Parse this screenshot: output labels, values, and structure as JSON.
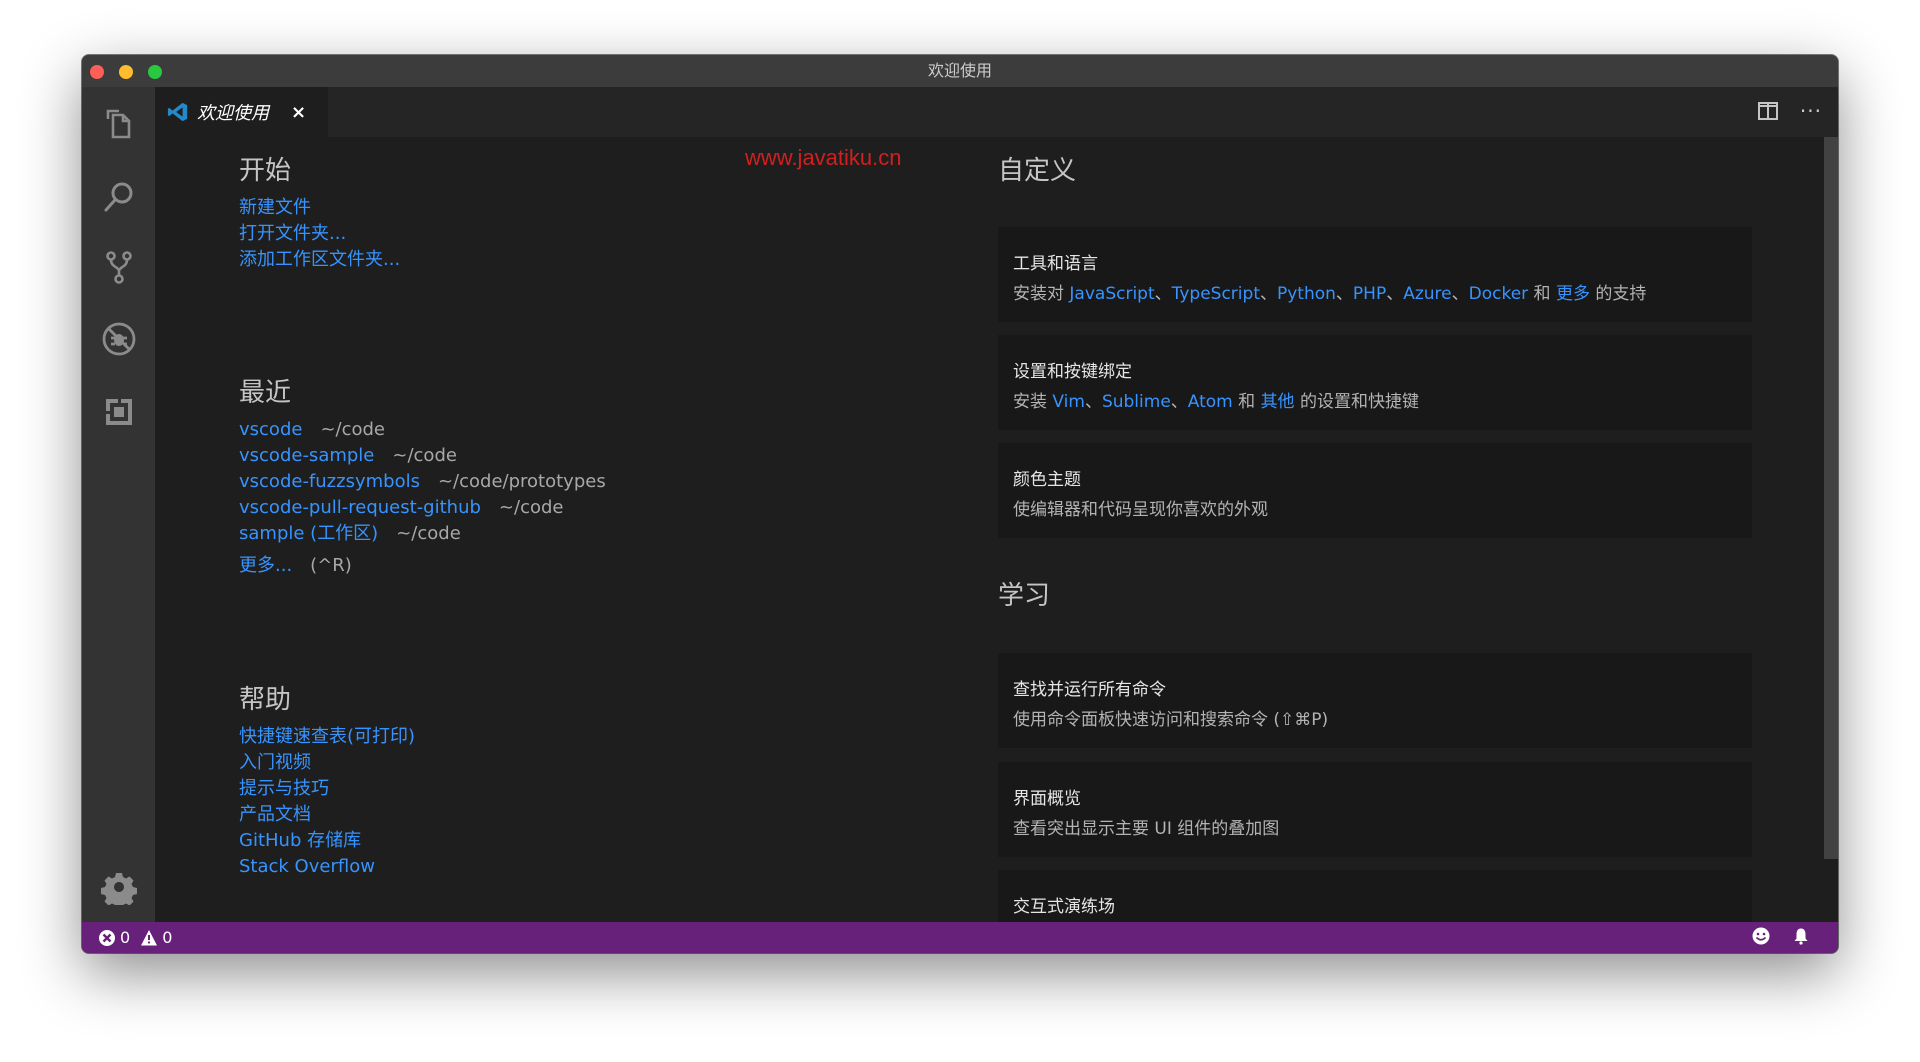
{
  "window": {
    "title": "欢迎使用"
  },
  "activity_bar": {
    "items": [
      {
        "name": "explorer",
        "icon": "files-icon"
      },
      {
        "name": "search",
        "icon": "search-icon"
      },
      {
        "name": "source-control",
        "icon": "source-control-icon"
      },
      {
        "name": "debug",
        "icon": "debug-icon"
      },
      {
        "name": "extensions",
        "icon": "extensions-icon"
      }
    ],
    "settings_icon": "gear-icon"
  },
  "tabs": [
    {
      "label": "欢迎使用",
      "close": "×",
      "active": true
    }
  ],
  "toolbar": {
    "split_icon": "split-editor-icon",
    "more_label": "···"
  },
  "watermark": "www.javatiku.cn",
  "start": {
    "heading": "开始",
    "links": [
      "新建文件",
      "打开文件夹...",
      "添加工作区文件夹..."
    ]
  },
  "recent": {
    "heading": "最近",
    "items": [
      {
        "name": "vscode",
        "path": "~/code"
      },
      {
        "name": "vscode-sample",
        "path": "~/code"
      },
      {
        "name": "vscode-fuzzsymbols",
        "path": "~/code/prototypes"
      },
      {
        "name": "vscode-pull-request-github",
        "path": "~/code"
      },
      {
        "name": "sample (工作区)",
        "path": "~/code"
      }
    ],
    "more_label": "更多...",
    "more_shortcut": "(^R)"
  },
  "help": {
    "heading": "帮助",
    "links": [
      "快捷键速查表(可打印)",
      "入门视频",
      "提示与技巧",
      "产品文档",
      "GitHub 存储库",
      "Stack Overflow"
    ]
  },
  "customize": {
    "heading": "自定义",
    "tools": {
      "title": "工具和语言",
      "prefix": "安装对 ",
      "langs": [
        "JavaScript",
        "TypeScript",
        "Python",
        "PHP",
        "Azure",
        "Docker"
      ],
      "sep": "、",
      "and": " 和 ",
      "more": "更多",
      "suffix": " 的支持"
    },
    "keybindings": {
      "title": "设置和按键绑定",
      "prefix": "安装 ",
      "editors": [
        "Vim",
        "Sublime",
        "Atom"
      ],
      "sep": "、",
      "and": " 和 ",
      "other": "其他",
      "suffix": " 的设置和快捷键"
    },
    "theme": {
      "title": "颜色主题",
      "desc": "使编辑器和代码呈现你喜欢的外观"
    }
  },
  "learn": {
    "heading": "学习",
    "commands": {
      "title": "查找并运行所有命令",
      "desc": "使用命令面板快速访问和搜索命令 (⇧⌘P)"
    },
    "overview": {
      "title": "界面概览",
      "desc": "查看突出显示主要 UI 组件的叠加图"
    },
    "playground": {
      "title": "交互式演练场"
    }
  },
  "status_bar": {
    "errors": "0",
    "warnings": "0",
    "feedback_icon": "smiley-icon",
    "notifications_icon": "bell-icon",
    "color": "#68217a"
  },
  "colors": {
    "link": "#3794ff",
    "editor_bg": "#1e1e1e",
    "activity_bar_bg": "#333333",
    "title_bar_bg": "#3c3c3c",
    "watermark": "#d21f1f"
  }
}
